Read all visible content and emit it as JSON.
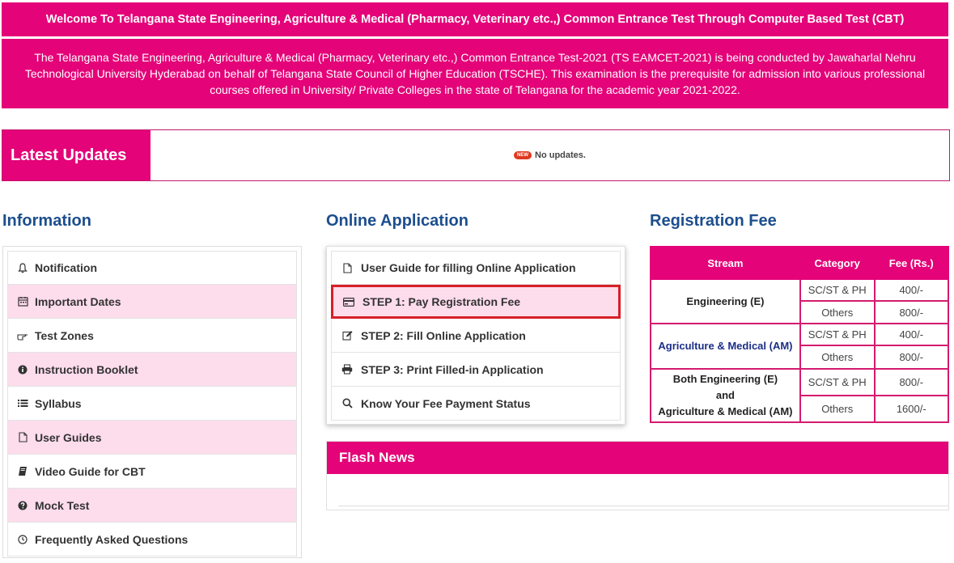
{
  "banner": {
    "title": "Welcome To Telangana State Engineering, Agriculture & Medical (Pharmacy, Veterinary etc.,) Common Entrance Test Through Computer Based Test (CBT)",
    "description": "The Telangana State Engineering, Agriculture & Medical (Pharmacy, Veterinary etc.,) Common Entrance Test-2021 (TS EAMCET-2021) is being conducted by Jawaharlal Nehru Technological University Hyderabad on behalf of Telangana State Council of Higher Education (TSCHE). This examination is the prerequisite for admission into various professional courses offered in University/ Private Colleges in the state of Telangana for the academic year 2021-2022."
  },
  "updates": {
    "label": "Latest Updates",
    "badge": "NEW",
    "message": "No updates."
  },
  "information": {
    "heading": "Information",
    "items": [
      {
        "label": "Notification",
        "icon": "bell-icon"
      },
      {
        "label": "Important Dates",
        "icon": "calendar-icon"
      },
      {
        "label": "Test Zones",
        "icon": "pointing-hand-icon"
      },
      {
        "label": "Instruction Booklet",
        "icon": "info-icon"
      },
      {
        "label": "Syllabus",
        "icon": "list-icon"
      },
      {
        "label": "User Guides",
        "icon": "document-icon"
      },
      {
        "label": "Video Guide for CBT",
        "icon": "book-icon"
      },
      {
        "label": "Mock Test",
        "icon": "question-icon"
      },
      {
        "label": "Frequently Asked Questions",
        "icon": "clock-icon"
      }
    ]
  },
  "online_application": {
    "heading": "Online Application",
    "items": [
      {
        "label": "User Guide for filling Online Application",
        "icon": "document-icon"
      },
      {
        "label": "STEP 1: Pay Registration Fee",
        "icon": "credit-card-icon"
      },
      {
        "label": "STEP 2: Fill Online Application",
        "icon": "edit-icon"
      },
      {
        "label": "STEP 3: Print Filled-in Application",
        "icon": "print-icon"
      },
      {
        "label": "Know Your Fee Payment Status",
        "icon": "search-icon"
      }
    ]
  },
  "flash_news": {
    "heading": "Flash News"
  },
  "registration_fee": {
    "heading": "Registration Fee",
    "columns": [
      "Stream",
      "Category",
      "Fee (Rs.)"
    ],
    "rows": [
      {
        "stream": "Engineering (E)",
        "fees": [
          {
            "category": "SC/ST & PH",
            "fee": "400/-"
          },
          {
            "category": "Others",
            "fee": "800/-"
          }
        ]
      },
      {
        "stream": "Agriculture & Medical (AM)",
        "fees": [
          {
            "category": "SC/ST & PH",
            "fee": "400/-"
          },
          {
            "category": "Others",
            "fee": "800/-"
          }
        ]
      },
      {
        "stream_lines": [
          "Both Engineering (E)",
          "and",
          "Agriculture & Medical (AM)"
        ],
        "fees": [
          {
            "category": "SC/ST & PH",
            "fee": "800/-"
          },
          {
            "category": "Others",
            "fee": "1600/-"
          }
        ]
      }
    ]
  },
  "colors": {
    "brand": "#e40378",
    "heading": "#1c4e8e",
    "highlight_border": "#d71f26",
    "alt_row": "#fddcec"
  }
}
